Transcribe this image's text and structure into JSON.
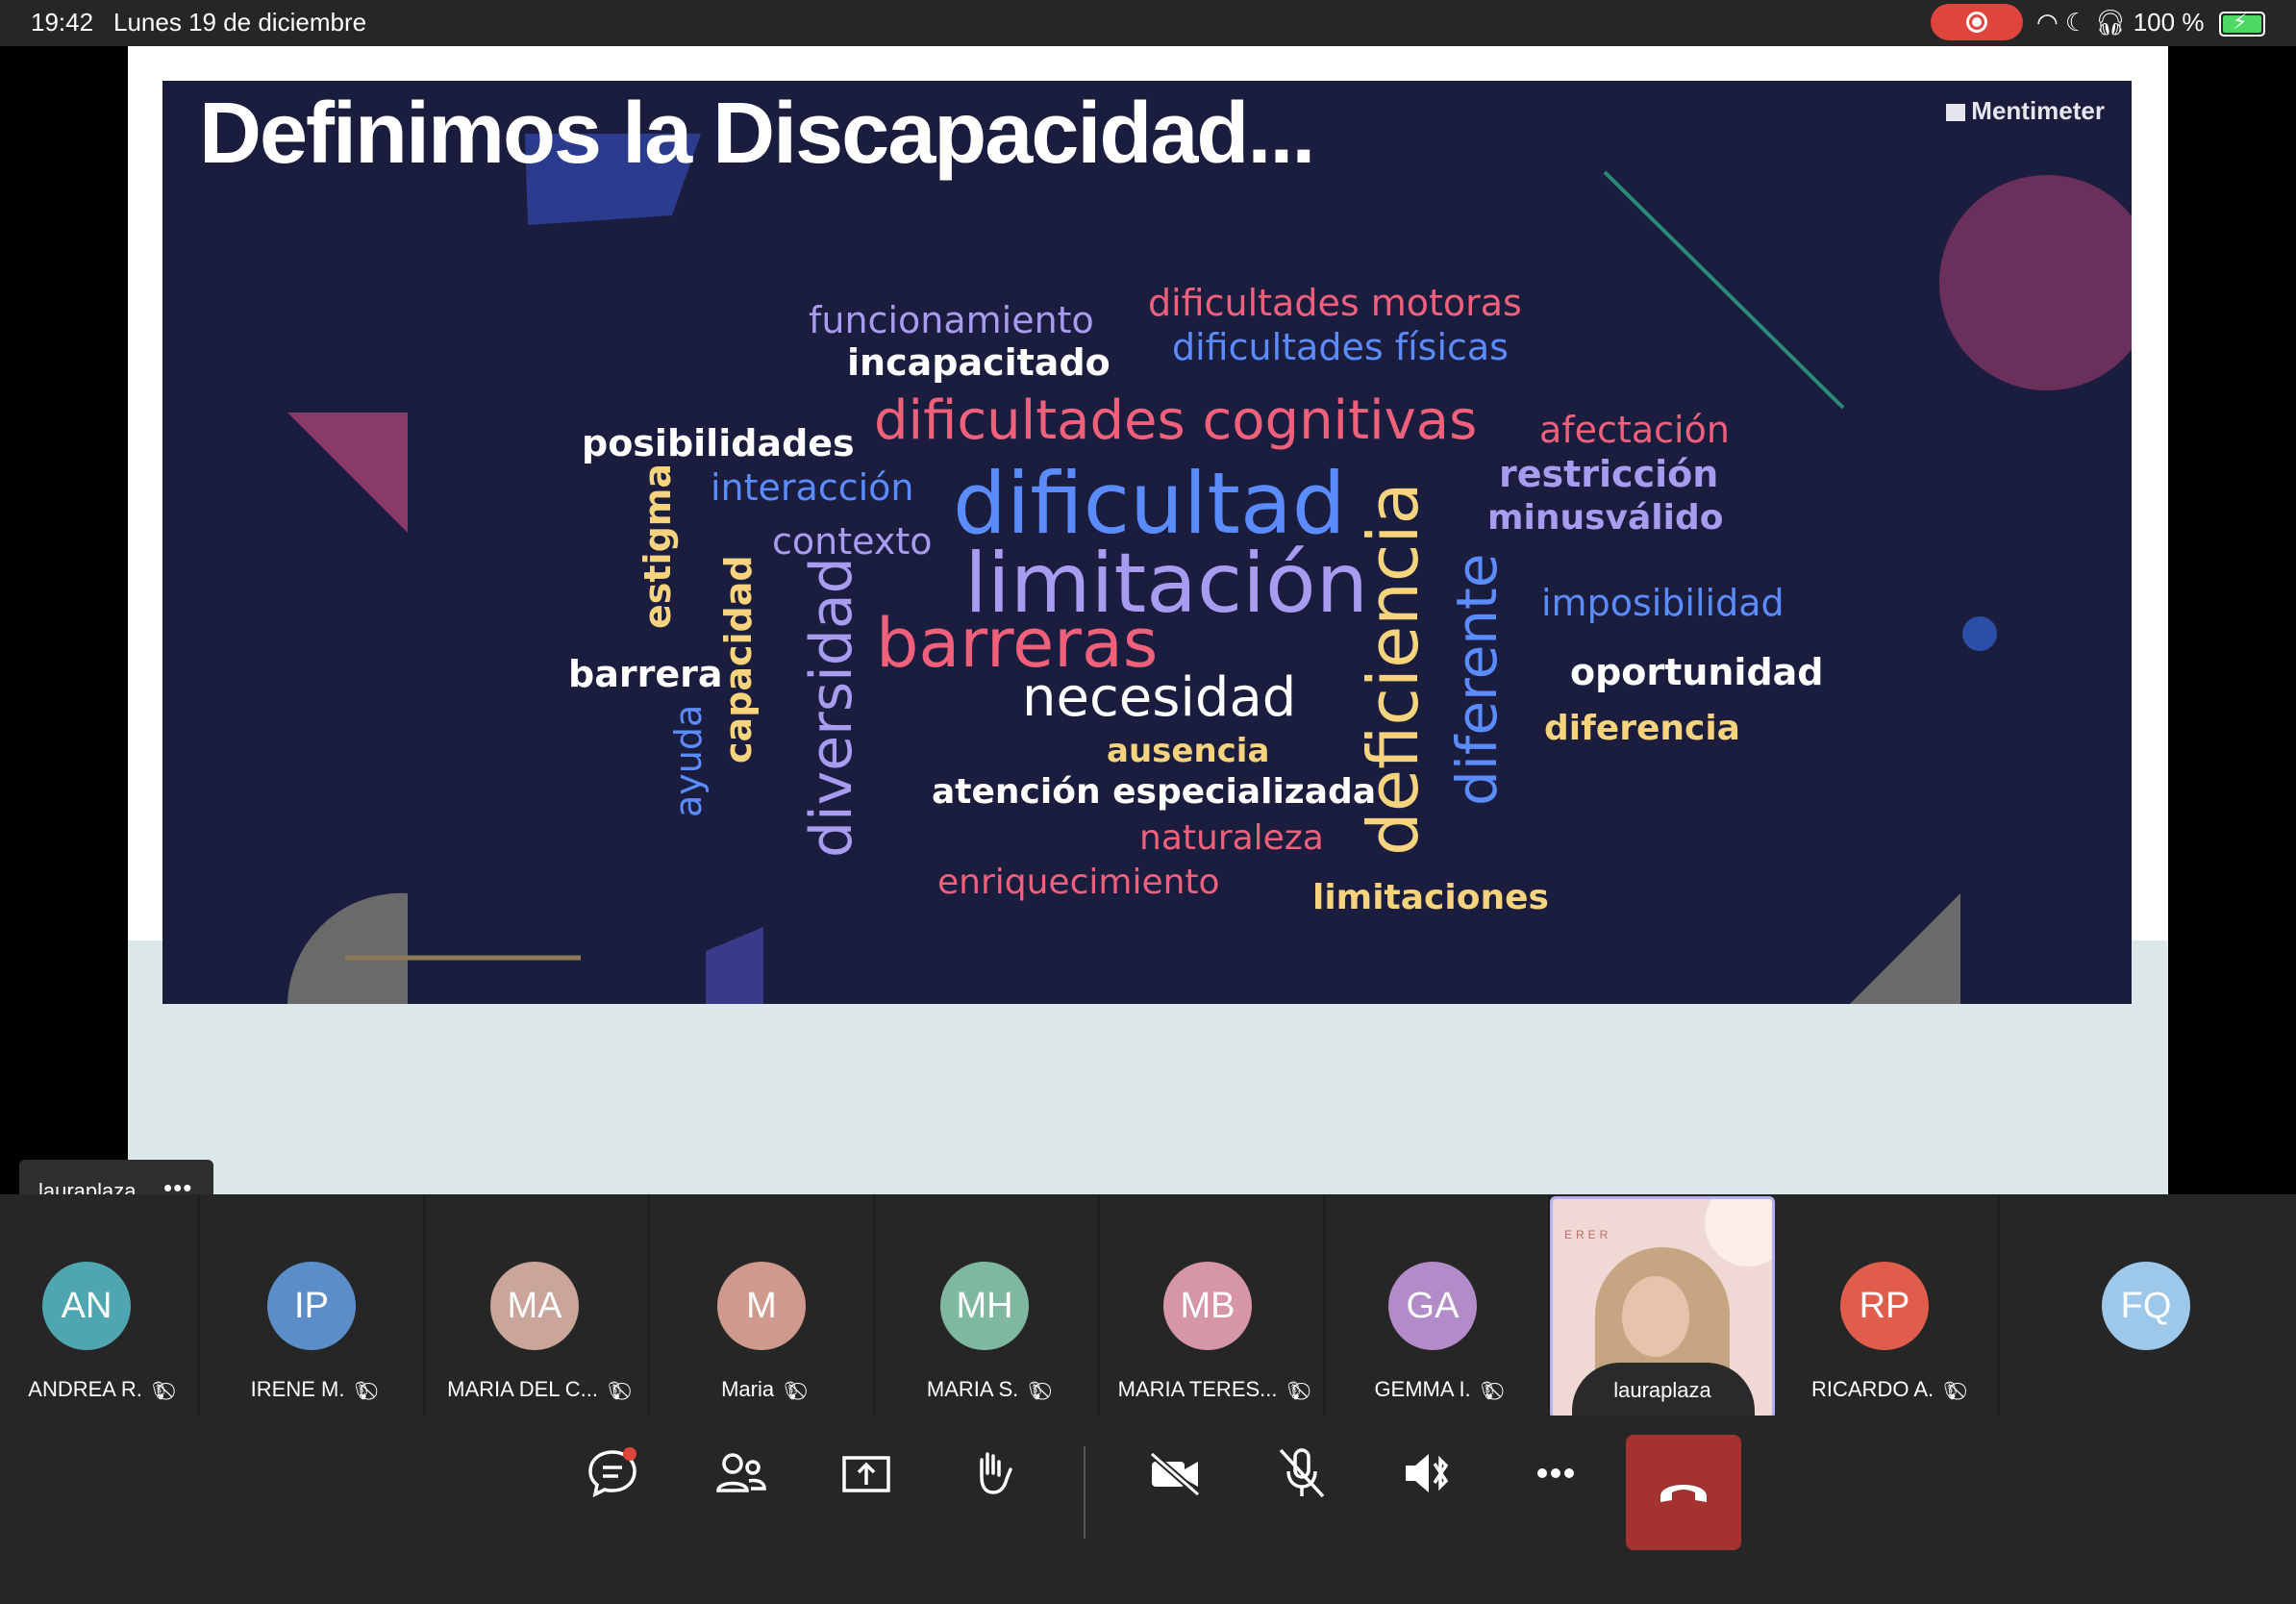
{
  "status_bar": {
    "time": "19:42",
    "date": "Lunes 19 de diciembre",
    "battery": "100 %",
    "recording_color": "#e0453d"
  },
  "slide": {
    "title": "Definimos la Discapacidad...",
    "brand": "Mentimeter",
    "background": "#1b1d3f",
    "words": [
      {
        "text": "funcionamiento",
        "color": "#a79cf0"
      },
      {
        "text": "incapacitado",
        "color": "#ffffff"
      },
      {
        "text": "dificultades motoras",
        "color": "#f0607a"
      },
      {
        "text": "dificultades físicas",
        "color": "#5b8cff"
      },
      {
        "text": "dificultades cognitivas",
        "color": "#f0607a"
      },
      {
        "text": "posibilidades",
        "color": "#ffffff"
      },
      {
        "text": "interacción",
        "color": "#5b8cff"
      },
      {
        "text": "afectación",
        "color": "#f0607a"
      },
      {
        "text": "restricción",
        "color": "#a79cf0"
      },
      {
        "text": "minusválido",
        "color": "#a79cf0"
      },
      {
        "text": "dificultad",
        "color": "#5b8cff"
      },
      {
        "text": "contexto",
        "color": "#a79cf0"
      },
      {
        "text": "limitación",
        "color": "#a79cf0"
      },
      {
        "text": "estigma",
        "color": "#f6d37c"
      },
      {
        "text": "capacidad",
        "color": "#f6d37c"
      },
      {
        "text": "diversidad",
        "color": "#a79cf0"
      },
      {
        "text": "barreras",
        "color": "#f0607a"
      },
      {
        "text": "barrera",
        "color": "#ffffff"
      },
      {
        "text": "ayuda",
        "color": "#5b8cff"
      },
      {
        "text": "deficiencia",
        "color": "#f6d37c"
      },
      {
        "text": "diferente",
        "color": "#5b8cff"
      },
      {
        "text": "imposibilidad",
        "color": "#5b8cff"
      },
      {
        "text": "oportunidad",
        "color": "#ffffff"
      },
      {
        "text": "diferencia",
        "color": "#f6d37c"
      },
      {
        "text": "necesidad",
        "color": "#ffffff"
      },
      {
        "text": "ausencia",
        "color": "#f6d37c"
      },
      {
        "text": "atención especializada",
        "color": "#ffffff"
      },
      {
        "text": "naturaleza",
        "color": "#f0607a"
      },
      {
        "text": "enriquecimiento",
        "color": "#f0607a"
      },
      {
        "text": "limitaciones",
        "color": "#f6d37c"
      }
    ]
  },
  "speaker_tag": {
    "name": "lauraplaza",
    "more": "•••"
  },
  "participants": [
    {
      "initials": "AN",
      "name": "ANDREA R.",
      "color": "#4fa6b0",
      "muted": true
    },
    {
      "initials": "IP",
      "name": "IRENE M.",
      "color": "#5b8dc9",
      "muted": true
    },
    {
      "initials": "MA",
      "name": "MARIA DEL C...",
      "color": "#c9a59a",
      "muted": true
    },
    {
      "initials": "M",
      "name": "Maria",
      "color": "#d0998e",
      "muted": true
    },
    {
      "initials": "MH",
      "name": "MARIA S.",
      "color": "#7fb8a1",
      "muted": true
    },
    {
      "initials": "MB",
      "name": "MARIA TERES...",
      "color": "#d795a8",
      "muted": true
    },
    {
      "initials": "GA",
      "name": "GEMMA I.",
      "color": "#b38bc9",
      "muted": true
    },
    {
      "initials": "",
      "name": "lauraplaza",
      "color": "#f0d9d5",
      "muted": false,
      "video_brand": "ERER"
    },
    {
      "initials": "RP",
      "name": "RICARDO A.",
      "color": "#e05c4b",
      "muted": true
    },
    {
      "initials": "FQ",
      "name": "",
      "color": "#9ec8ea",
      "muted": false
    }
  ],
  "muted_icon": "mic-off-icon",
  "toolbar": {
    "buttons": [
      "chat-icon",
      "people-icon",
      "share-screen-icon",
      "raise-hand-icon",
      "camera-off-icon",
      "mic-off-icon",
      "speaker-bluetooth-icon",
      "more-icon",
      "end-call-icon"
    ],
    "end_call_color": "#a4332f"
  }
}
